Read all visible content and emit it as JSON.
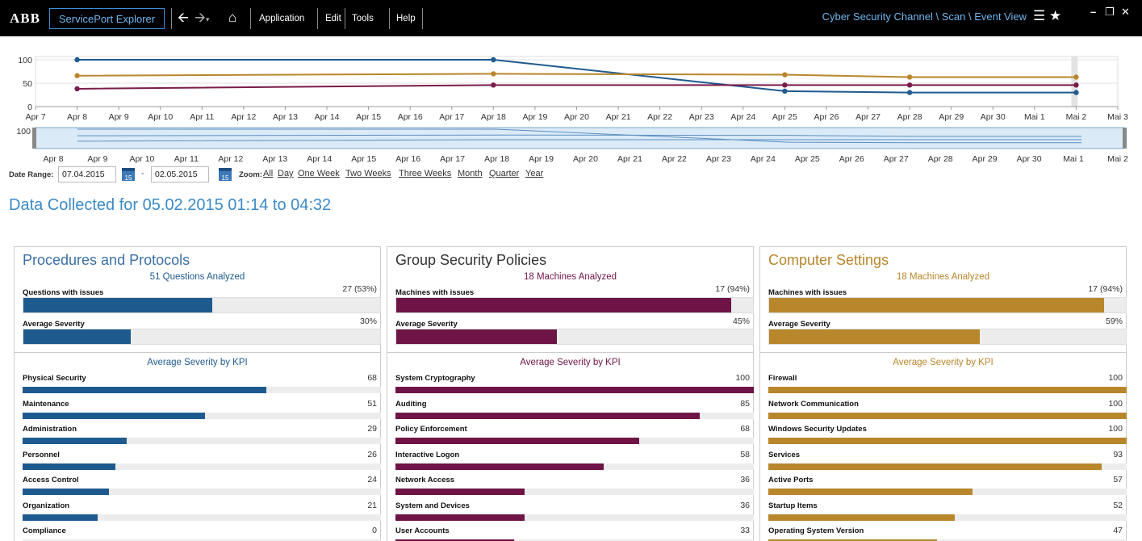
{
  "header": {
    "logo": "ABB",
    "product": "ServicePort Explorer",
    "menu": [
      "Application",
      "Edit",
      "Tools",
      "Help"
    ],
    "breadcrumb": "Cyber Security Channel \\ Scan \\ Event View",
    "icons": [
      "back-arrow-icon",
      "forward-arrow-icon",
      "home-icon",
      "menu-icon",
      "star-icon",
      "minimize-icon",
      "restore-icon",
      "close-icon"
    ]
  },
  "chart_data": [
    {
      "type": "line",
      "x": [
        "Apr 8",
        "Apr 18",
        "Apr 25",
        "Apr 28",
        "Mai 2"
      ],
      "series": [
        {
          "color": "#1f5a8e",
          "values": [
            100,
            100,
            33,
            30,
            30
          ]
        },
        {
          "color": "#b8862b",
          "values": [
            66,
            70,
            68,
            63,
            63
          ]
        },
        {
          "color": "#7a1b4a",
          "values": [
            38,
            46,
            46,
            46,
            46
          ]
        }
      ],
      "ylim": [
        0,
        100
      ],
      "yticks": [
        "100",
        "50",
        "0"
      ],
      "xticks": [
        "Apr 7",
        "Apr 8",
        "Apr 9",
        "Apr 10",
        "Apr 11",
        "Apr 12",
        "Apr 13",
        "Apr 14",
        "Apr 15",
        "Apr 16",
        "Apr 17",
        "Apr 18",
        "Apr 19",
        "Apr 20",
        "Apr 21",
        "Apr 22",
        "Apr 23",
        "Apr 24",
        "Apr 25",
        "Apr 26",
        "Apr 27",
        "Apr 28",
        "Apr 29",
        "Apr 30",
        "Mai 1",
        "Mai 2",
        "Mai 3"
      ],
      "grid": true
    },
    {
      "type": "line",
      "role": "range-navigator",
      "yticks": [
        "100"
      ],
      "xticks": [
        "Apr 8",
        "Apr 9",
        "Apr 10",
        "Apr 11",
        "Apr 12",
        "Apr 13",
        "Apr 14",
        "Apr 15",
        "Apr 16",
        "Apr 17",
        "Apr 18",
        "Apr 19",
        "Apr 20",
        "Apr 21",
        "Apr 22",
        "Apr 23",
        "Apr 24",
        "Apr 25",
        "Apr 26",
        "Apr 27",
        "Apr 28",
        "Apr 29",
        "Apr 30",
        "Mai 1",
        "Mai 2"
      ]
    }
  ],
  "date_range": {
    "label": "Date Range:",
    "from": "07.04.2015",
    "to": "02.05.2015",
    "separator": "-",
    "calendar_icon_text": "15",
    "zoom_label": "Zoom:",
    "zoom_options": [
      "All",
      "Day",
      "One Week",
      "Two Weeks",
      "Three Weeks",
      "Month",
      "Quarter",
      "Year"
    ]
  },
  "collected": "Data Collected for 05.02.2015 01:14  to 04:32",
  "panels": [
    {
      "title": "Procedures and Protocols",
      "color": "#1f5a8e",
      "title_color": "#3b6fa5",
      "analyzed": "51 Questions Analyzed",
      "issues_label": "Questions with issues",
      "issues_value": "27 (53%)",
      "issues_fraction": 0.53,
      "severity_label": "Average Severity",
      "severity_value": "30%",
      "severity_fraction": 0.3,
      "kpi_header": "Average Severity by KPI",
      "kpis": [
        {
          "label": "Physical Security",
          "value": "68"
        },
        {
          "label": "Maintenance",
          "value": "51"
        },
        {
          "label": "Administration",
          "value": "29"
        },
        {
          "label": "Personnel",
          "value": "26"
        },
        {
          "label": "Access Control",
          "value": "24"
        },
        {
          "label": "Organization",
          "value": "21"
        },
        {
          "label": "Compliance",
          "value": "0"
        }
      ]
    },
    {
      "title": "Group Security Policies",
      "color": "#6e1446",
      "title_color": "#333333",
      "analyzed": "18 Machines Analyzed",
      "issues_label": "Machines with issues",
      "issues_value": "17 (94%)",
      "issues_fraction": 0.94,
      "severity_label": "Average Severity",
      "severity_value": "45%",
      "severity_fraction": 0.45,
      "kpi_header": "Average Severity by KPI",
      "kpis": [
        {
          "label": "System Cryptography",
          "value": "100"
        },
        {
          "label": "Auditing",
          "value": "85"
        },
        {
          "label": "Policy Enforcement",
          "value": "68"
        },
        {
          "label": "Interactive Logon",
          "value": "58"
        },
        {
          "label": "Network Access",
          "value": "36"
        },
        {
          "label": "System and Devices",
          "value": "36"
        },
        {
          "label": "User Accounts",
          "value": "33"
        }
      ]
    },
    {
      "title": "Computer Settings",
      "color": "#b8862b",
      "title_color": "#b8862b",
      "analyzed": "18 Machines Analyzed",
      "issues_label": "Machines with issues",
      "issues_value": "17 (94%)",
      "issues_fraction": 0.94,
      "severity_label": "Average Severity",
      "severity_value": "59%",
      "severity_fraction": 0.59,
      "kpi_header": "Average Severity by KPI",
      "kpis": [
        {
          "label": "Firewall",
          "value": "100"
        },
        {
          "label": "Network Communication",
          "value": "100"
        },
        {
          "label": "Windows Security Updates",
          "value": "100"
        },
        {
          "label": "Services",
          "value": "93"
        },
        {
          "label": "Active Ports",
          "value": "57"
        },
        {
          "label": "Startup Items",
          "value": "52"
        },
        {
          "label": "Operating System Version",
          "value": "47"
        }
      ]
    }
  ]
}
